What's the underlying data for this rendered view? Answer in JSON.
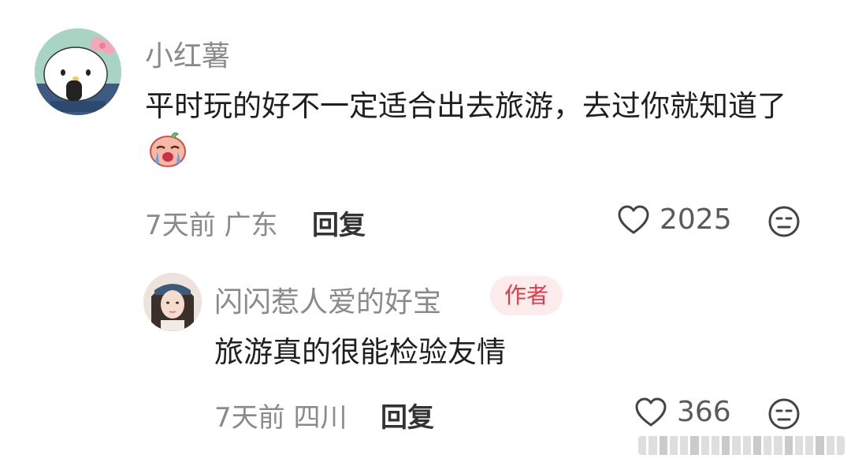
{
  "comments": [
    {
      "username": "小红薯",
      "content": "平时玩的好不一定适合出去旅游，去过你就知道了",
      "emoji_icon": "crying-face-emoji",
      "time": "7天前",
      "location": "广东",
      "reply_label": "回复",
      "likes": "2025"
    }
  ],
  "replies": [
    {
      "username": "闪闪惹人爱的好宝",
      "badge": "作者",
      "content": "旅游真的很能检验友情",
      "time": "7天前",
      "location": "四川",
      "reply_label": "回复",
      "likes": "366"
    }
  ],
  "colors": {
    "badge_bg": "#fdecec",
    "badge_text": "#e8384a",
    "meta_text": "#8a8a8a"
  }
}
